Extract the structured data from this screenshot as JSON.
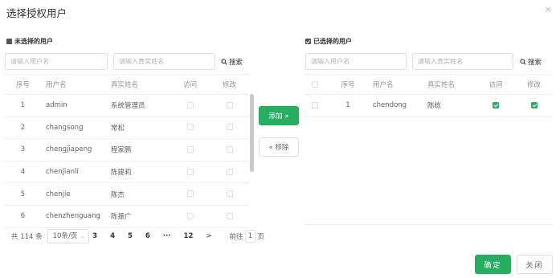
{
  "dialog": {
    "title": "选择授权用户",
    "close": "×"
  },
  "left": {
    "label": "未选择的用户",
    "username_placeholder": "请输入用户名",
    "realname_placeholder": "请输入真实姓名",
    "search_label": "搜索",
    "columns": [
      "序号",
      "用户名",
      "真实姓名",
      "访问",
      "修改"
    ],
    "rows": [
      {
        "no": "1",
        "username": "admin",
        "realname": "系统管理员",
        "access": false,
        "modify": false
      },
      {
        "no": "2",
        "username": "changsong",
        "realname": "常松",
        "access": false,
        "modify": false
      },
      {
        "no": "3",
        "username": "chengjiapeng",
        "realname": "程家鹏",
        "access": false,
        "modify": false
      },
      {
        "no": "4",
        "username": "chenjianli",
        "realname": "陈建莉",
        "access": false,
        "modify": false
      },
      {
        "no": "5",
        "username": "chenjie",
        "realname": "陈杰",
        "access": false,
        "modify": false
      },
      {
        "no": "6",
        "username": "chenzhenguang",
        "realname": "陈振广",
        "access": false,
        "modify": false
      }
    ],
    "pager": {
      "total": "共 114 条",
      "page_size": "10条/页",
      "pages": [
        "3",
        "4",
        "5",
        "6",
        "···",
        "12"
      ],
      "next": ">",
      "goto_prefix": "前往",
      "goto_value": "1",
      "goto_suffix": "页"
    }
  },
  "actions": {
    "add": "添加 »",
    "remove": "« 移除"
  },
  "right": {
    "label": "已选择的用户",
    "username_placeholder": "请输入用户名",
    "realname_placeholder": "请输入真实姓名",
    "search_label": "搜索",
    "columns": [
      "序号",
      "用户名",
      "真实姓名",
      "访问",
      "修改"
    ],
    "rows": [
      {
        "no": "1",
        "username": "chendong",
        "realname": "陈栋",
        "access": true,
        "modify": true
      }
    ]
  },
  "footer": {
    "ok": "确定",
    "close": "关闭"
  },
  "colors": {
    "accent": "#27ae60",
    "border": "#ebeef5"
  }
}
